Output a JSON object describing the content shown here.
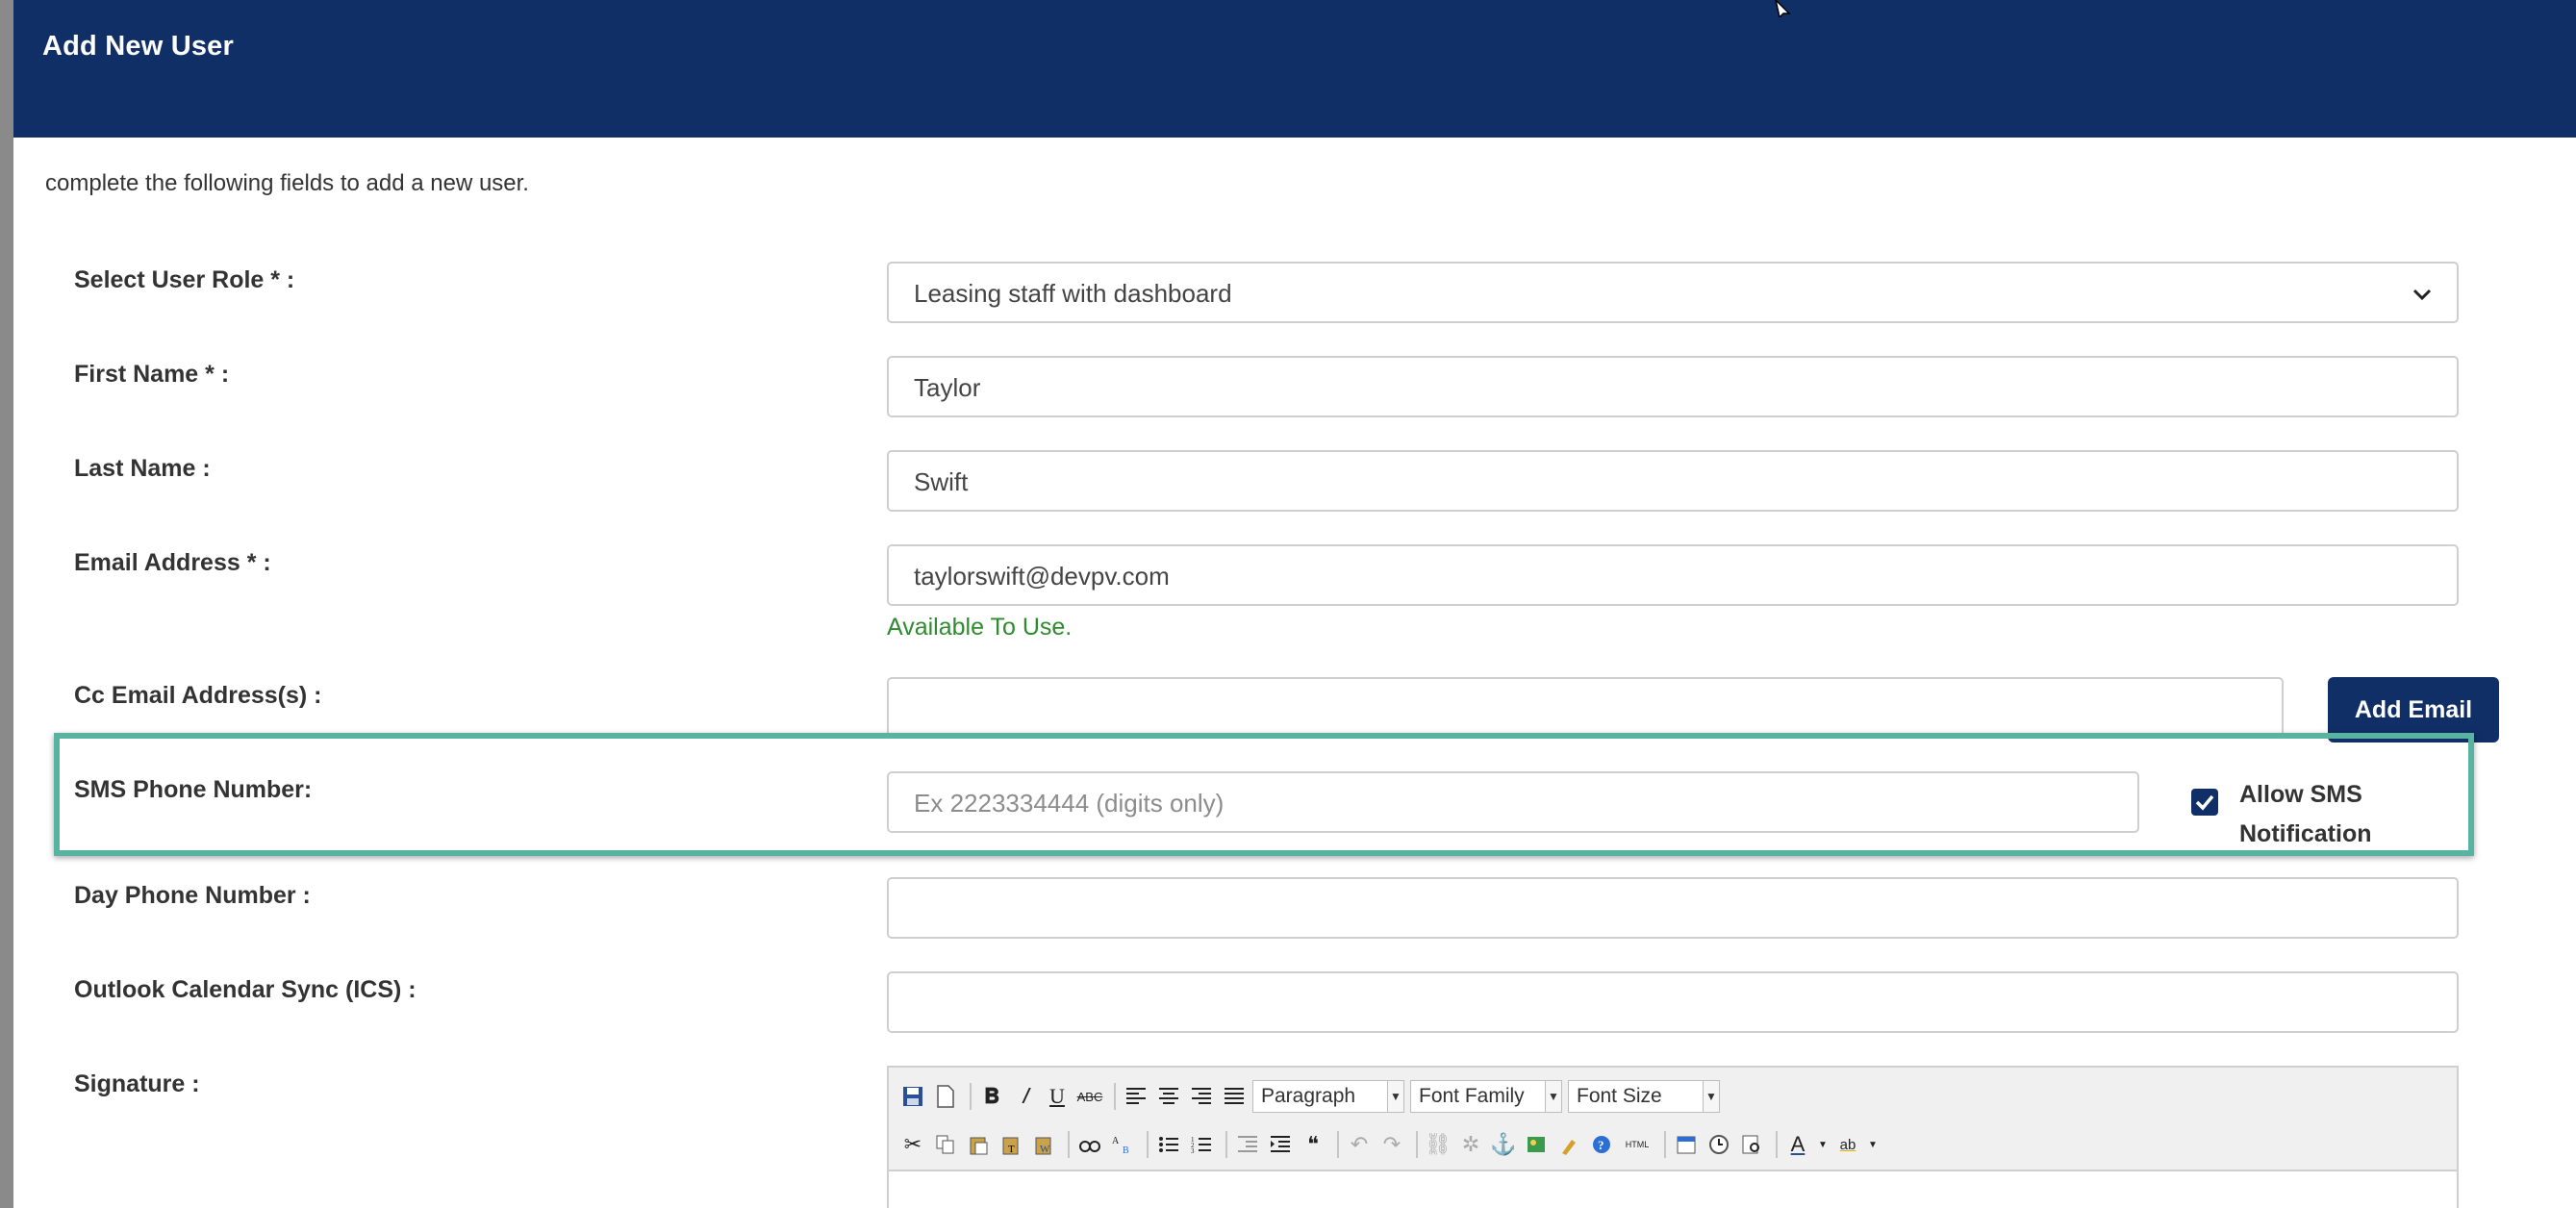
{
  "header": {
    "title": "Add New User"
  },
  "intro": "complete the following fields to add a new user.",
  "fields": {
    "role": {
      "label": "Select User Role * :",
      "value": "Leasing staff with dashboard"
    },
    "first_name": {
      "label": "First Name * :",
      "value": "Taylor"
    },
    "last_name": {
      "label": "Last Name :",
      "value": "Swift"
    },
    "email": {
      "label": "Email Address * :",
      "value": "taylorswift@devpv.com",
      "status": "Available To Use."
    },
    "cc_email": {
      "label": "Cc Email Address(s) :",
      "value": "",
      "button": "Add Email"
    },
    "sms": {
      "label": "SMS Phone Number:",
      "placeholder": "Ex 2223334444 (digits only)",
      "checkbox_label": "Allow SMS Notification",
      "checked": true
    },
    "day_phone": {
      "label": "Day Phone Number :",
      "value": ""
    },
    "outlook": {
      "label": "Outlook Calendar Sync (ICS) :",
      "value": ""
    },
    "signature": {
      "label": "Signature :"
    }
  },
  "editor": {
    "format_select": "Paragraph",
    "font_family_select": "Font Family",
    "font_size_select": "Font Size"
  },
  "colors": {
    "header_bg": "#102f67",
    "highlight": "#58b3a1",
    "status_green": "#2e8b2e"
  }
}
